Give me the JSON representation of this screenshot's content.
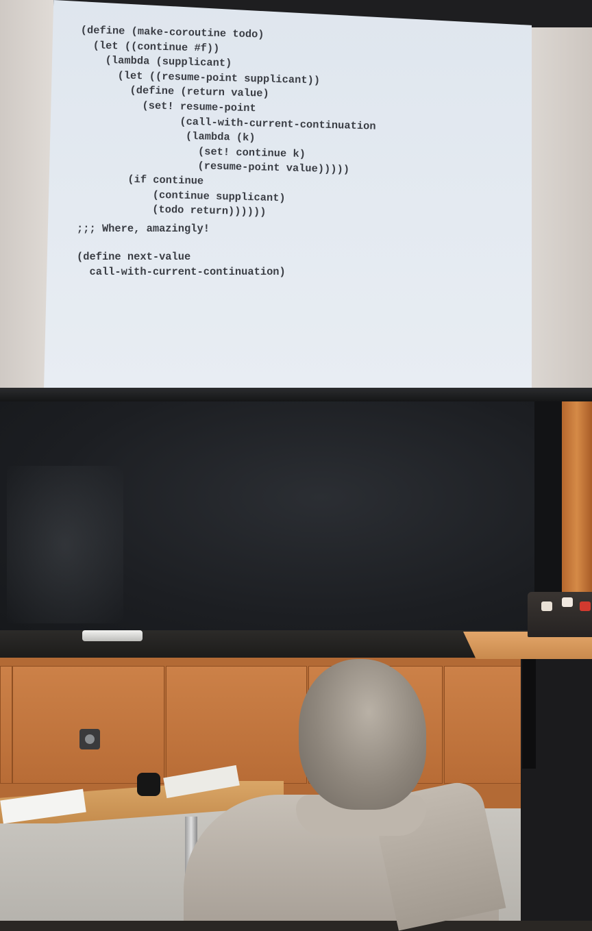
{
  "slide": {
    "code_lines": [
      "(define (make-coroutine todo)",
      "  (let ((continue #f))",
      "    (lambda (supplicant)",
      "      (let ((resume-point supplicant))",
      "        (define (return value)",
      "          (set! resume-point",
      "                (call-with-current-continuation",
      "                 (lambda (k)",
      "                   (set! continue k)",
      "                   (resume-point value)))))",
      "        (if continue",
      "            (continue supplicant)",
      "            (todo return))))))"
    ],
    "comment": ";;; Where, amazingly!",
    "code2_lines": [
      "(define next-value",
      "  call-with-current-continuation)"
    ]
  }
}
